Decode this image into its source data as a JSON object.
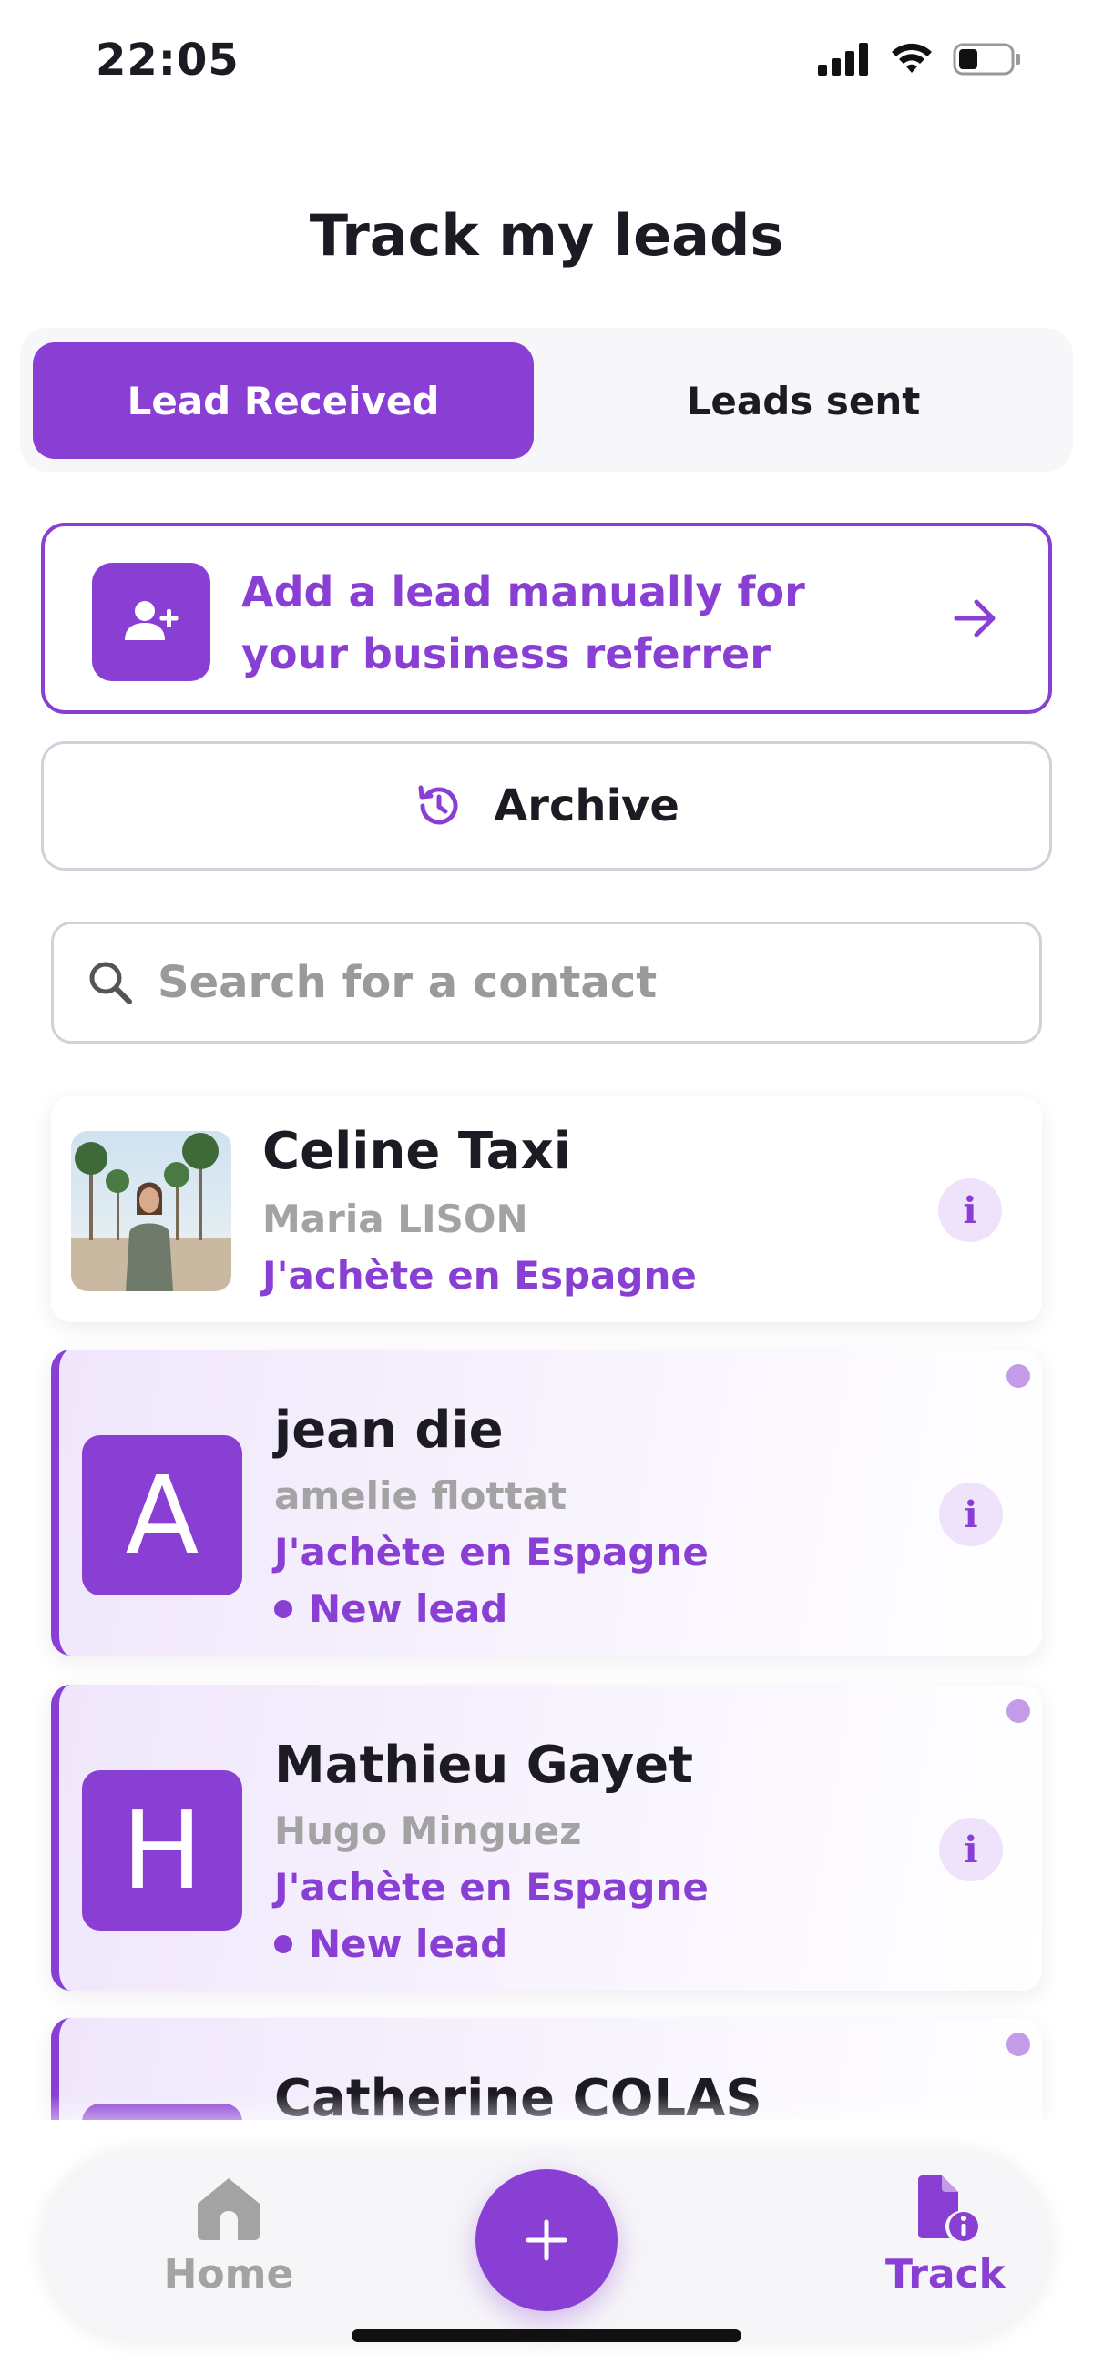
{
  "status_bar": {
    "time": "22:05"
  },
  "page": {
    "title": "Track my leads"
  },
  "tabs": [
    {
      "label": "Lead Received",
      "active": true
    },
    {
      "label": "Leads sent",
      "active": false
    }
  ],
  "add_lead": {
    "label": "Add a lead manually for your business referrer",
    "icon": "user-plus-icon"
  },
  "archive": {
    "label": "Archive",
    "icon": "history-icon"
  },
  "search": {
    "placeholder": "Search for a contact",
    "value": ""
  },
  "leads": [
    {
      "name": "Celine Taxi",
      "referrer": "Maria LISON",
      "program": "J'achète en Espagne",
      "avatar_type": "photo",
      "status": "",
      "is_new": false
    },
    {
      "name": "jean die",
      "referrer": "amelie flottat",
      "program": "J'achète en Espagne",
      "avatar_letter": "A",
      "status": "New lead",
      "is_new": true
    },
    {
      "name": "Mathieu Gayet",
      "referrer": "Hugo Minguez",
      "program": "J'achète en Espagne",
      "avatar_letter": "H",
      "status": "New lead",
      "is_new": true
    },
    {
      "name": "Catherine COLAS",
      "referrer": "",
      "program": "",
      "status": "",
      "is_new": true
    }
  ],
  "info_label": "i",
  "bottom_nav": {
    "home_label": "Home",
    "track_label": "Track",
    "fab_label": "+"
  },
  "colors": {
    "accent": "#8a3fd4",
    "muted_text": "#a3a3a3",
    "dark_text": "#1c1a22"
  }
}
